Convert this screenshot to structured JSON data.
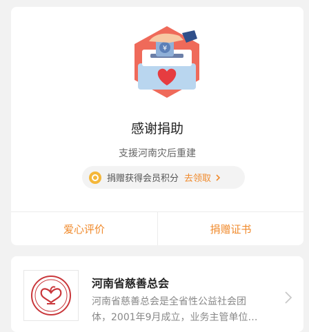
{
  "thanks": {
    "title": "感谢捐助",
    "project": "支援河南灾后重建",
    "points": {
      "text": "捐赠获得会员积分",
      "link": "去领取",
      "icon": "coin-icon"
    },
    "actions": {
      "review": "爱心评价",
      "certificate": "捐赠证书"
    }
  },
  "organization": {
    "name": "河南省慈善总会",
    "desc_line1": "河南省慈善总会是全省性公益社会团",
    "desc_line2": "体，2001年9月成立，业务主管单位…"
  },
  "colors": {
    "accent": "#f08a2c",
    "coin": "#f4b73a",
    "hexagon": "#ef6a5a",
    "heart": "#e63c40",
    "background": "#f2f2f2"
  }
}
